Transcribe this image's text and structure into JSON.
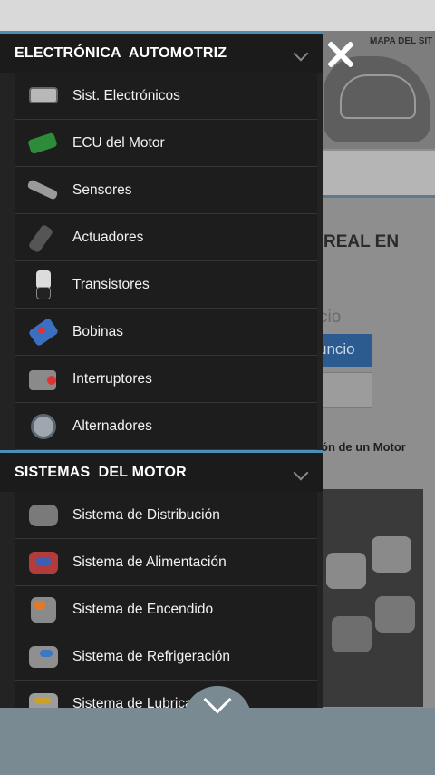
{
  "background_page": {
    "map_label": "MAPA DEL SIT",
    "heading_fragment": "REAL EN",
    "field_fragment": "cio",
    "button_fragment": "uncio",
    "motor_fragment": "ón de un Motor"
  },
  "drawer": {
    "sections": [
      {
        "title": "ELECTRÓNICA  AUTOMOTRIZ",
        "items": [
          {
            "label": "Sist. Electrónicos",
            "icon": "electronic-module-icon"
          },
          {
            "label": "ECU del Motor",
            "icon": "ecu-board-icon"
          },
          {
            "label": "Sensores",
            "icon": "sensor-icon"
          },
          {
            "label": "Actuadores",
            "icon": "injector-icon"
          },
          {
            "label": "Transistores",
            "icon": "transistor-icon"
          },
          {
            "label": "Bobinas",
            "icon": "ignition-coil-icon"
          },
          {
            "label": "Interruptores",
            "icon": "switch-icon"
          },
          {
            "label": "Alternadores",
            "icon": "alternator-icon"
          }
        ]
      },
      {
        "title": "SISTEMAS  DEL MOTOR",
        "items": [
          {
            "label": "Sistema de Distribución",
            "icon": "timing-system-icon"
          },
          {
            "label": "Sistema de Alimentación",
            "icon": "fuel-system-icon"
          },
          {
            "label": "Sistema de Encendido",
            "icon": "ignition-system-icon"
          },
          {
            "label": "Sistema de Refrigeración",
            "icon": "cooling-system-icon"
          },
          {
            "label": "Sistema de Lubrica",
            "icon": "lubrication-system-icon"
          }
        ]
      }
    ]
  },
  "colors": {
    "accent": "#4a8fb5",
    "drawer_bg": "#232323",
    "bottom_bar": "#7a8a93"
  }
}
